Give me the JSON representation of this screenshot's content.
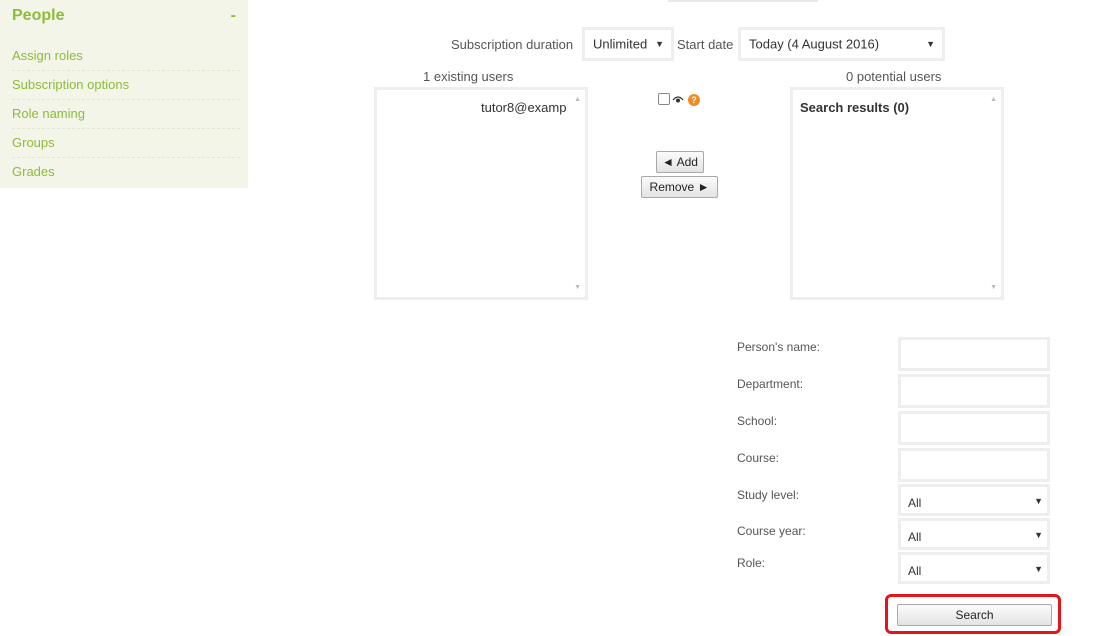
{
  "sidebar": {
    "title": "People",
    "collapse": "-",
    "items": [
      {
        "label": "Assign roles"
      },
      {
        "label": "Subscription options"
      },
      {
        "label": "Role naming"
      },
      {
        "label": "Groups"
      },
      {
        "label": "Grades"
      }
    ]
  },
  "subscription": {
    "duration_label": "Subscription duration",
    "duration_value": "Unlimited",
    "start_label": "Start date",
    "start_value": "Today (4 August 2016)"
  },
  "existing": {
    "heading": "1 existing users",
    "options": [
      "tutor8@examp"
    ]
  },
  "potential": {
    "heading": "0 potential users",
    "options": [
      "Search results (0)"
    ]
  },
  "actions": {
    "add_label": "◄ Add",
    "remove_label": "Remove ►",
    "help_glyph": "?"
  },
  "search_form": {
    "fields": [
      {
        "label": "Person's name:"
      },
      {
        "label": "Department:"
      },
      {
        "label": "School:"
      },
      {
        "label": "Course:"
      }
    ],
    "selects": [
      {
        "label": "Study level:",
        "value": "All"
      },
      {
        "label": "Course year:",
        "value": "All"
      },
      {
        "label": "Role:",
        "value": "All"
      }
    ],
    "submit_label": "Search"
  },
  "colors": {
    "accent": "#8dbb3c",
    "highlight": "#e3151a",
    "help": "#f08a24"
  }
}
